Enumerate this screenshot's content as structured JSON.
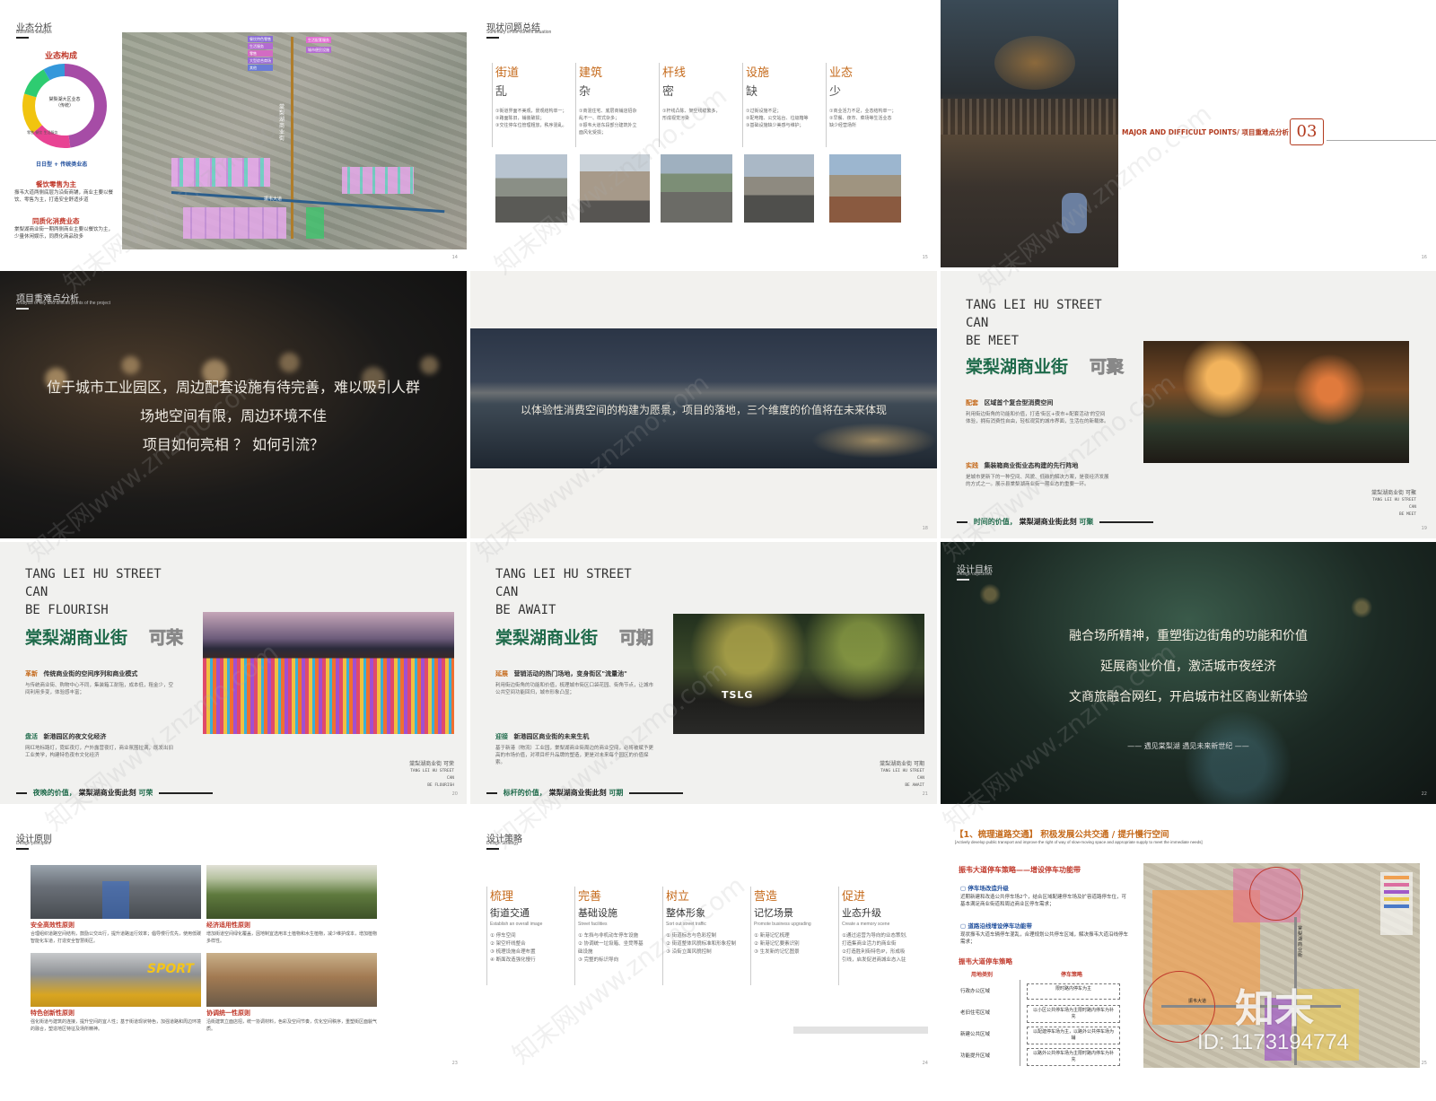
{
  "s14": {
    "title": "业态分析",
    "subtitle": "Business analysis",
    "composition": "业态构成",
    "donut_center": [
      "棠梨湖大区业态",
      "（传统）"
    ],
    "donut_legend": [
      "零售",
      "餐饮",
      "生活服务"
    ],
    "daily": "日日型 + 传统类业态",
    "food_head": "餐饮零售为主",
    "food_text": "振韦大道两侧底层为沿街商铺，商业主要以餐饮、零售为主，打造安全舒适步道",
    "homog_head": "同质化消费业态",
    "homog_text": "棠梨湖商业街一期两侧商业主要以餐饮为主，少量休闲娱乐，同质化商品较多",
    "map_road_v": "棠梨湖商业街",
    "map_road_h": "振韦大道",
    "legend": [
      "餐饮特色零售",
      "生活服务",
      "零售",
      "大型综合商场",
      "其他"
    ],
    "legend_r": [
      "生活配套服务",
      "城市便民设施"
    ],
    "page": "14"
  },
  "s15": {
    "title": "现状问题总结",
    "subtitle": "Summary of the current situation",
    "cols": [
      {
        "h": "街道",
        "s": "乱",
        "t": [
          "①街道界面不美观，景观结构单一；",
          "②路面陈旧，铺装破损；",
          "③交往停车位管理粗放，秩序混乱。"
        ]
      },
      {
        "h": "建筑",
        "s": "杂",
        "t": [
          "①商混住宅、底层商铺店招杂",
          "乱不一、样式杂多；",
          "②振韦大道东段部分建筑外立",
          "面风化受损；"
        ]
      },
      {
        "h": "杆线",
        "s": "密",
        "t": [
          "①杆线凸陈、架空线缆繁多，",
          "形成视觉污染"
        ]
      },
      {
        "h": "设施",
        "s": "缺",
        "t": [
          "①过街设施不足；",
          "②配电箱、公交站台、垃圾箱等",
          "③基础设施缺少美感与维护；"
        ]
      },
      {
        "h": "业态",
        "s": "少",
        "t": [
          "①商业活力不足，业态结构单一；",
          "②早餐、夜市、菜场等生活业态",
          "缺少经营场所"
        ]
      }
    ],
    "page": "15"
  },
  "s16": {
    "banner": "MAJOR AND DIFFICULT POINTS/ 项目重难点分析",
    "num": "03",
    "page": "16"
  },
  "s17": {
    "title": "项目重难点分析",
    "subtitle": "Analysis of key and difficult points of the project",
    "lines": [
      "位于城市工业园区，周边配套设施有待完善，难以吸引人群",
      "场地空间有限，周边环境不佳",
      "项目如何亮相 ？ 如何引流？"
    ]
  },
  "s18": {
    "text": "以体验性消费空间的构建为愿景，项目的落地，三个维度的价值将在未来体现",
    "page": "18"
  },
  "s19": {
    "en": [
      "TANG LEI HU STREET",
      "CAN",
      "BE MEET"
    ],
    "cn": "棠梨湖商业街",
    "tag": "可聚",
    "p1h": "配套",
    "p1t": "区域首个复合型消费空间",
    "p1d": "利用街边街角的功能和价值，打造'街区+夜市+配套活动'的空间体验，拥有消费性自由，轻松观赏的城市界面，生活在的新载体。",
    "p2h": "实践",
    "p2t": "集装箱商业街业态构建的先行阵地",
    "p2d": "是城市更新下的一种空间、风貌、低碳的解决方案，是夜经济发展的方式之一。展示县棠梨湖商业街一期业态的重要一环。",
    "footer_a": "时间的价值，",
    "footer_b": "棠梨湖商业街此刻",
    "footer_c": "可聚",
    "side": [
      "棠梨湖商业街  可聚",
      "TANG LEI HU STREET",
      "CAN",
      "BE MEET"
    ],
    "page": "19"
  },
  "s20": {
    "en": [
      "TANG LEI HU STREET",
      "CAN",
      "BE FLOURISH"
    ],
    "cn": "棠梨湖商业街",
    "tag": "可荣",
    "p1h": "革新",
    "p1t": "传统商业街的空间序列和商业模式",
    "p1d": "与传统商业街、购物中心不同，集装箱工耐阻，成本低，租金少，空间利用多变，体验感丰富；",
    "p2h": "盘活",
    "p2t": "新港园区的夜文化经济",
    "p2d": "网红地标路灯，霓虹夜灯，户外露营夜灯，商业氛围拉满，既发出旧工业美学，构建特色夜市文化经济",
    "footer_a": "夜晚的价值，",
    "footer_b": "棠梨湖商业街此刻",
    "footer_c": "可荣",
    "side": [
      "棠梨湖商业街  可荣",
      "TANG LEI HU STREET",
      "CAN",
      "BE FLOURISH"
    ],
    "page": "20"
  },
  "s21": {
    "en": [
      "TANG LEI HU STREET",
      "CAN",
      "BE AWAIT"
    ],
    "cn": "棠梨湖商业街",
    "tag": "可期",
    "p1h": "延展",
    "p1t": "营销活动的热门场地，变身街区\"流量池\"",
    "p1d": "利用街边街角的功能和价值，梳理城市街区口袋花园、街角节点，让城市公共空间功能回归，城市形象凸显；",
    "p2h": "迎接",
    "p2t": "新港园区商业街的未来生机",
    "p2d": "基于新港（物流）工业园，棠梨湖商业街周边的商业空间，必将被赋予更高的市场价值，对项目杆升品牌的塑造，更是对未来每个园区的价值探索。",
    "footer_a": "标杆的价值，",
    "footer_b": "棠梨湖商业街此刻",
    "footer_c": "可期",
    "side": [
      "棠梨湖商业街  可期",
      "TANG LEI HU STREET",
      "CAN",
      "BE AWAIT"
    ],
    "sign": "TSLG",
    "page": "21"
  },
  "s22": {
    "title": "设计目标",
    "subtitle": "Design objectives",
    "lines": [
      "融合场所精神，重塑街边街角的功能和价值",
      "延展商业价值，激活城市夜经济",
      "文商旅融合网红，开启城市社区商业新体验"
    ],
    "tagline": "—— 遇见棠梨湖 遇见未来新世纪 ——",
    "page": "22"
  },
  "s23": {
    "title": "设计原则",
    "subtitle": "Design principles",
    "items": [
      {
        "h": "安全高效性原则",
        "t": "合理组织道路空间结构，鼓励公交出行，提升道路运行效率；倡导慢行优先，使用低碳智能化车道，打造安全智慧街区。"
      },
      {
        "h": "经济适用性原则",
        "t": "增加街道空间绿化覆盖，因地制宜选用本土植物和水生植物，减少维护成本，增加植物多样性。"
      },
      {
        "h": "特色创新性原则",
        "t": "强化街道与建筑的连接，提升空间的宜人性；基于街道现状特色，加强道路和周边环境的融合，塑造地区特征及场所精神。"
      },
      {
        "h": "协调统一性原则",
        "t": "沿街建筑立面店招，统一协调材料，色彩及空间节奏，优化空间秩序，重塑街区面貌气质。"
      }
    ],
    "sport": "SPORT",
    "page": "23"
  },
  "s24": {
    "title": "设计策略",
    "subtitle": "Design Strategy",
    "cols": [
      {
        "h": "梳理",
        "s": "街道交通",
        "e": "Establish an overall image",
        "t": [
          "① 停车空间",
          "② 架空杆线整合",
          "③ 梳理设施合理布置",
          "④ 断面改造强化慢行"
        ]
      },
      {
        "h": "完善",
        "s": "基础设施",
        "e": "Street facilities",
        "t": [
          "① 车挡与非机动车停车设施",
          "② 协调统一垃圾箱、坐凳等基",
          "   础设施",
          "③ 完整的标识导向"
        ]
      },
      {
        "h": "树立",
        "s": "整体形象",
        "e": "Sort out street traffic",
        "t": [
          "① 街道标志与色彩控制",
          "② 街道整体风貌标准和形象控制",
          "③ 沿街立面风貌控制"
        ]
      },
      {
        "h": "营造",
        "s": "记忆场景",
        "e": "Promote business upgrading",
        "t": [
          "① 新港记忆梳理",
          "② 新港记忆要素识别",
          "③ 生发新的记忆图景"
        ]
      },
      {
        "h": "促进",
        "s": "业态升级",
        "e": "Create a memory scene",
        "t": [
          "①通过运营为导向的业态策划,",
          "打造集商业活力的商业街",
          "②打造胜利街特色IP，形成吸",
          "引线，启发促进商城业态入驻"
        ]
      }
    ],
    "page": "24"
  },
  "s25": {
    "title": "【1、梳理道路交通】 积极发展公共交通 / 提升慢行空间",
    "subtitle": "[Actively develop public transport and improve the right of way of slow-moving space and appropriate supply to meet the immediate needs]",
    "h1": "振韦大道停车策略——增设停车功能带",
    "b1h": "停车场改造升级",
    "b1t": "近期新建和改造公共停车场2个，结合区域配建停车场及扩容道路停车位，可基本满足商业街道和周边商业区停车需求；",
    "b2h": "道路沿线增设停车功能带",
    "b2t": "现状振韦大道车辆停车混乱，合理规划公共停车区域，解决振韦大道沿线停车需求；",
    "h2": "振韦大道停车策略",
    "th1": "用地类别",
    "th2": "停车策略",
    "rows": [
      {
        "a": "行政办公区域",
        "b": "限时路内停车为主"
      },
      {
        "a": "老旧住宅区域",
        "b": "以小区公共停车场为主限时路内停车为补充"
      },
      {
        "a": "新建公共区域",
        "b": "以配建停车场为主，以路外公共停车场为辅"
      },
      {
        "a": "功能提升区域",
        "b": "以路外公共停车场为主限时路内停车为补充"
      }
    ],
    "map_label": "振韦大道",
    "map_label_v": "棠梨湖商业街",
    "brand": "知末",
    "id_text": "ID: 1173194774",
    "page": "25"
  },
  "watermark": "知末网www.znzmo.com",
  "colors": {
    "green": "#1e6a4a",
    "orange": "#c56a1b",
    "red": "#c0392b",
    "map_bg": "#9a9a8a"
  }
}
